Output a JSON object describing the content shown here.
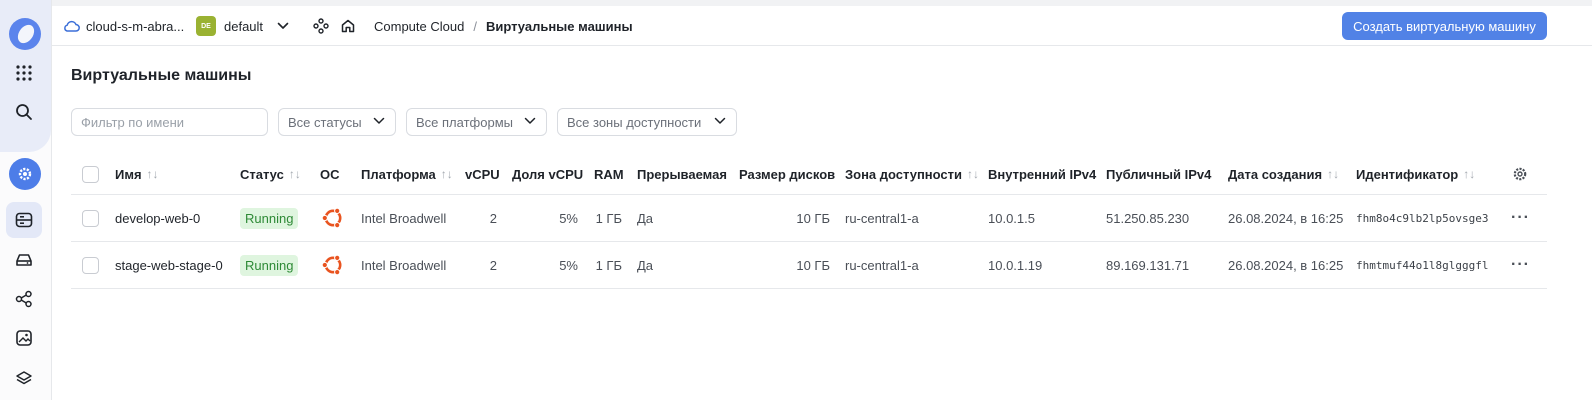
{
  "header": {
    "cloud_name": "cloud-s-m-abra...",
    "folder_badge": "DE",
    "folder_name": "default",
    "breadcrumb_service": "Compute Cloud",
    "breadcrumb_separator": "/",
    "breadcrumb_current": "Виртуальные машины",
    "create_button": "Создать виртуальную машину"
  },
  "page": {
    "title": "Виртуальные машины"
  },
  "filters": {
    "name_placeholder": "Фильтр по имени",
    "status": "Все статусы",
    "platform": "Все платформы",
    "zone": "Все зоны доступности"
  },
  "table": {
    "columns": {
      "name": "Имя",
      "status": "Статус",
      "os": "ОС",
      "platform": "Платформа",
      "vcpu": "vCPU",
      "vcpu_share": "Доля vCPU",
      "ram": "RAM",
      "preemptible": "Прерываемая",
      "disk_size": "Размер дисков",
      "zone": "Зона доступности",
      "internal_ip": "Внутренний IPv4",
      "public_ip": "Публичный IPv4",
      "created": "Дата создания",
      "id": "Идентификатор"
    },
    "sort_glyph": "↑↓",
    "rows": [
      {
        "name": "develop-web-0",
        "status": "Running",
        "os_icon": "ubuntu-icon",
        "platform": "Intel Broadwell",
        "vcpu": "2",
        "vcpu_share": "5%",
        "ram": "1 ГБ",
        "preemptible": "Да",
        "disk_size": "10 ГБ",
        "zone": "ru-central1-a",
        "internal_ip": "10.0.1.5",
        "public_ip": "51.250.85.230",
        "created": "26.08.2024, в 16:25",
        "id": "fhm8o4c9lb2lp5ovsge3",
        "menu": "···"
      },
      {
        "name": "stage-web-stage-0",
        "status": "Running",
        "os_icon": "ubuntu-icon",
        "platform": "Intel Broadwell",
        "vcpu": "2",
        "vcpu_share": "5%",
        "ram": "1 ГБ",
        "preemptible": "Да",
        "disk_size": "10 ГБ",
        "zone": "ru-central1-a",
        "internal_ip": "10.0.1.19",
        "public_ip": "89.169.131.71",
        "created": "26.08.2024, в 16:25",
        "id": "fhmtmuf44o1l8glgggfl",
        "menu": "···"
      }
    ]
  },
  "colors": {
    "accent": "#5182e6",
    "status_running_bg": "#dff5df",
    "status_running_text": "#2e8a36",
    "ubuntu": "#e95420",
    "folder_badge": "#9ab232"
  }
}
